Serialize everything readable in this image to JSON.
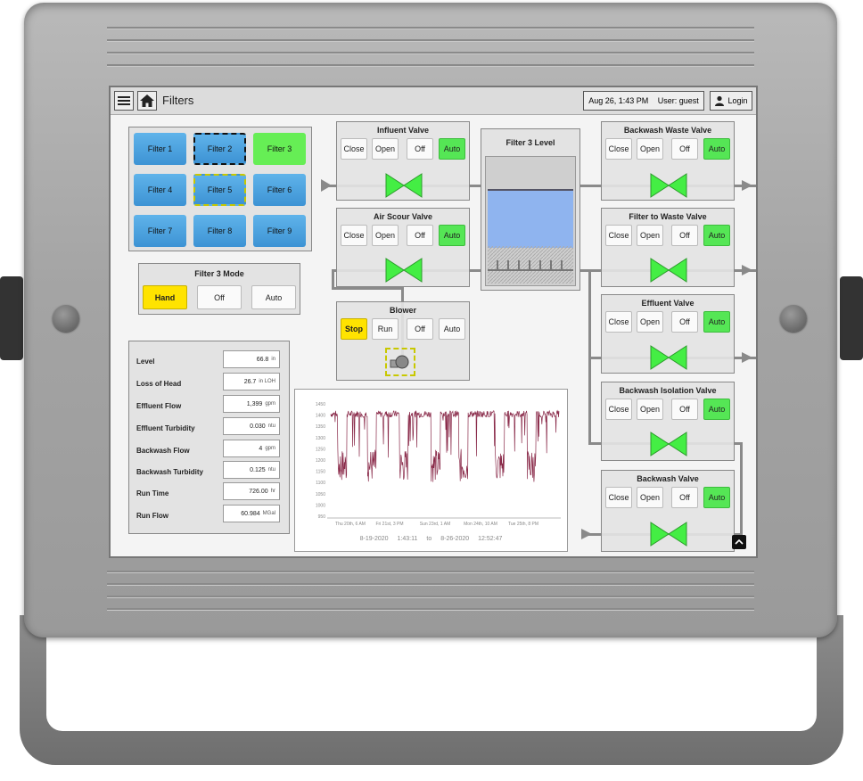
{
  "header": {
    "title": "Filters",
    "datetime": "Aug 26, 1:43 PM",
    "user": "User: guest",
    "login": "Login"
  },
  "filters": [
    "Filter 1",
    "Filter 2",
    "Filter 3",
    "Filter 4",
    "Filter 5",
    "Filter 6",
    "Filter 7",
    "Filter 8",
    "Filter 9"
  ],
  "mode": {
    "title": "Filter 3 Mode",
    "hand": "Hand",
    "off": "Off",
    "auto": "Auto"
  },
  "valve_buttons": {
    "close": "Close",
    "open": "Open",
    "off": "Off",
    "auto": "Auto"
  },
  "valves": {
    "influent": "Influent Valve",
    "air_scour": "Air Scour Valve",
    "backwash_waste": "Backwash Waste Valve",
    "filter_to_waste": "Filter to Waste Valve",
    "effluent": "Effluent Valve",
    "backwash_isolation": "Backwash Isolation Valve",
    "backwash": "Backwash Valve"
  },
  "blower": {
    "title": "Blower",
    "stop": "Stop",
    "run": "Run",
    "off": "Off",
    "auto": "Auto"
  },
  "level_panel": {
    "title": "Filter 3 Level"
  },
  "metrics": [
    {
      "label": "Level",
      "value": "66.8",
      "unit": "in"
    },
    {
      "label": "Loss of Head",
      "value": "26.7",
      "unit": "in LOH"
    },
    {
      "label": "Effluent Flow",
      "value": "1,399",
      "unit": "gpm"
    },
    {
      "label": "Effluent Turbidity",
      "value": "0.030",
      "unit": "ntu"
    },
    {
      "label": "Backwash Flow",
      "value": "4",
      "unit": "gpm"
    },
    {
      "label": "Backwash Turbidity",
      "value": "0.125",
      "unit": "ntu"
    },
    {
      "label": "Run Time",
      "value": "726.00",
      "unit": "hr"
    },
    {
      "label": "Run Flow",
      "value": "60.984",
      "unit": "MGal"
    }
  ],
  "trend": {
    "y_ticks": [
      "1450",
      "1400",
      "1350",
      "1300",
      "1250",
      "1200",
      "1150",
      "1100",
      "1050",
      "1000",
      "950"
    ],
    "x_ticks": [
      "Thu 20th, 6 AM",
      "Fri 21st, 3 PM",
      "Sun 23rd, 1 AM",
      "Mon 24th, 10 AM",
      "Tue 25th, 8 PM"
    ],
    "start_date": "8-19-2020",
    "start_time": "1:43:11",
    "to": "to",
    "end_date": "8-26-2020",
    "end_time": "12:52:47",
    "line_color": "#8a2b4a"
  },
  "colors": {
    "auto": "#55e655",
    "filter": "#4aa3e0",
    "selected_filter": "#66ee55",
    "hand": "#ffe300",
    "valve": "#44ee44"
  }
}
